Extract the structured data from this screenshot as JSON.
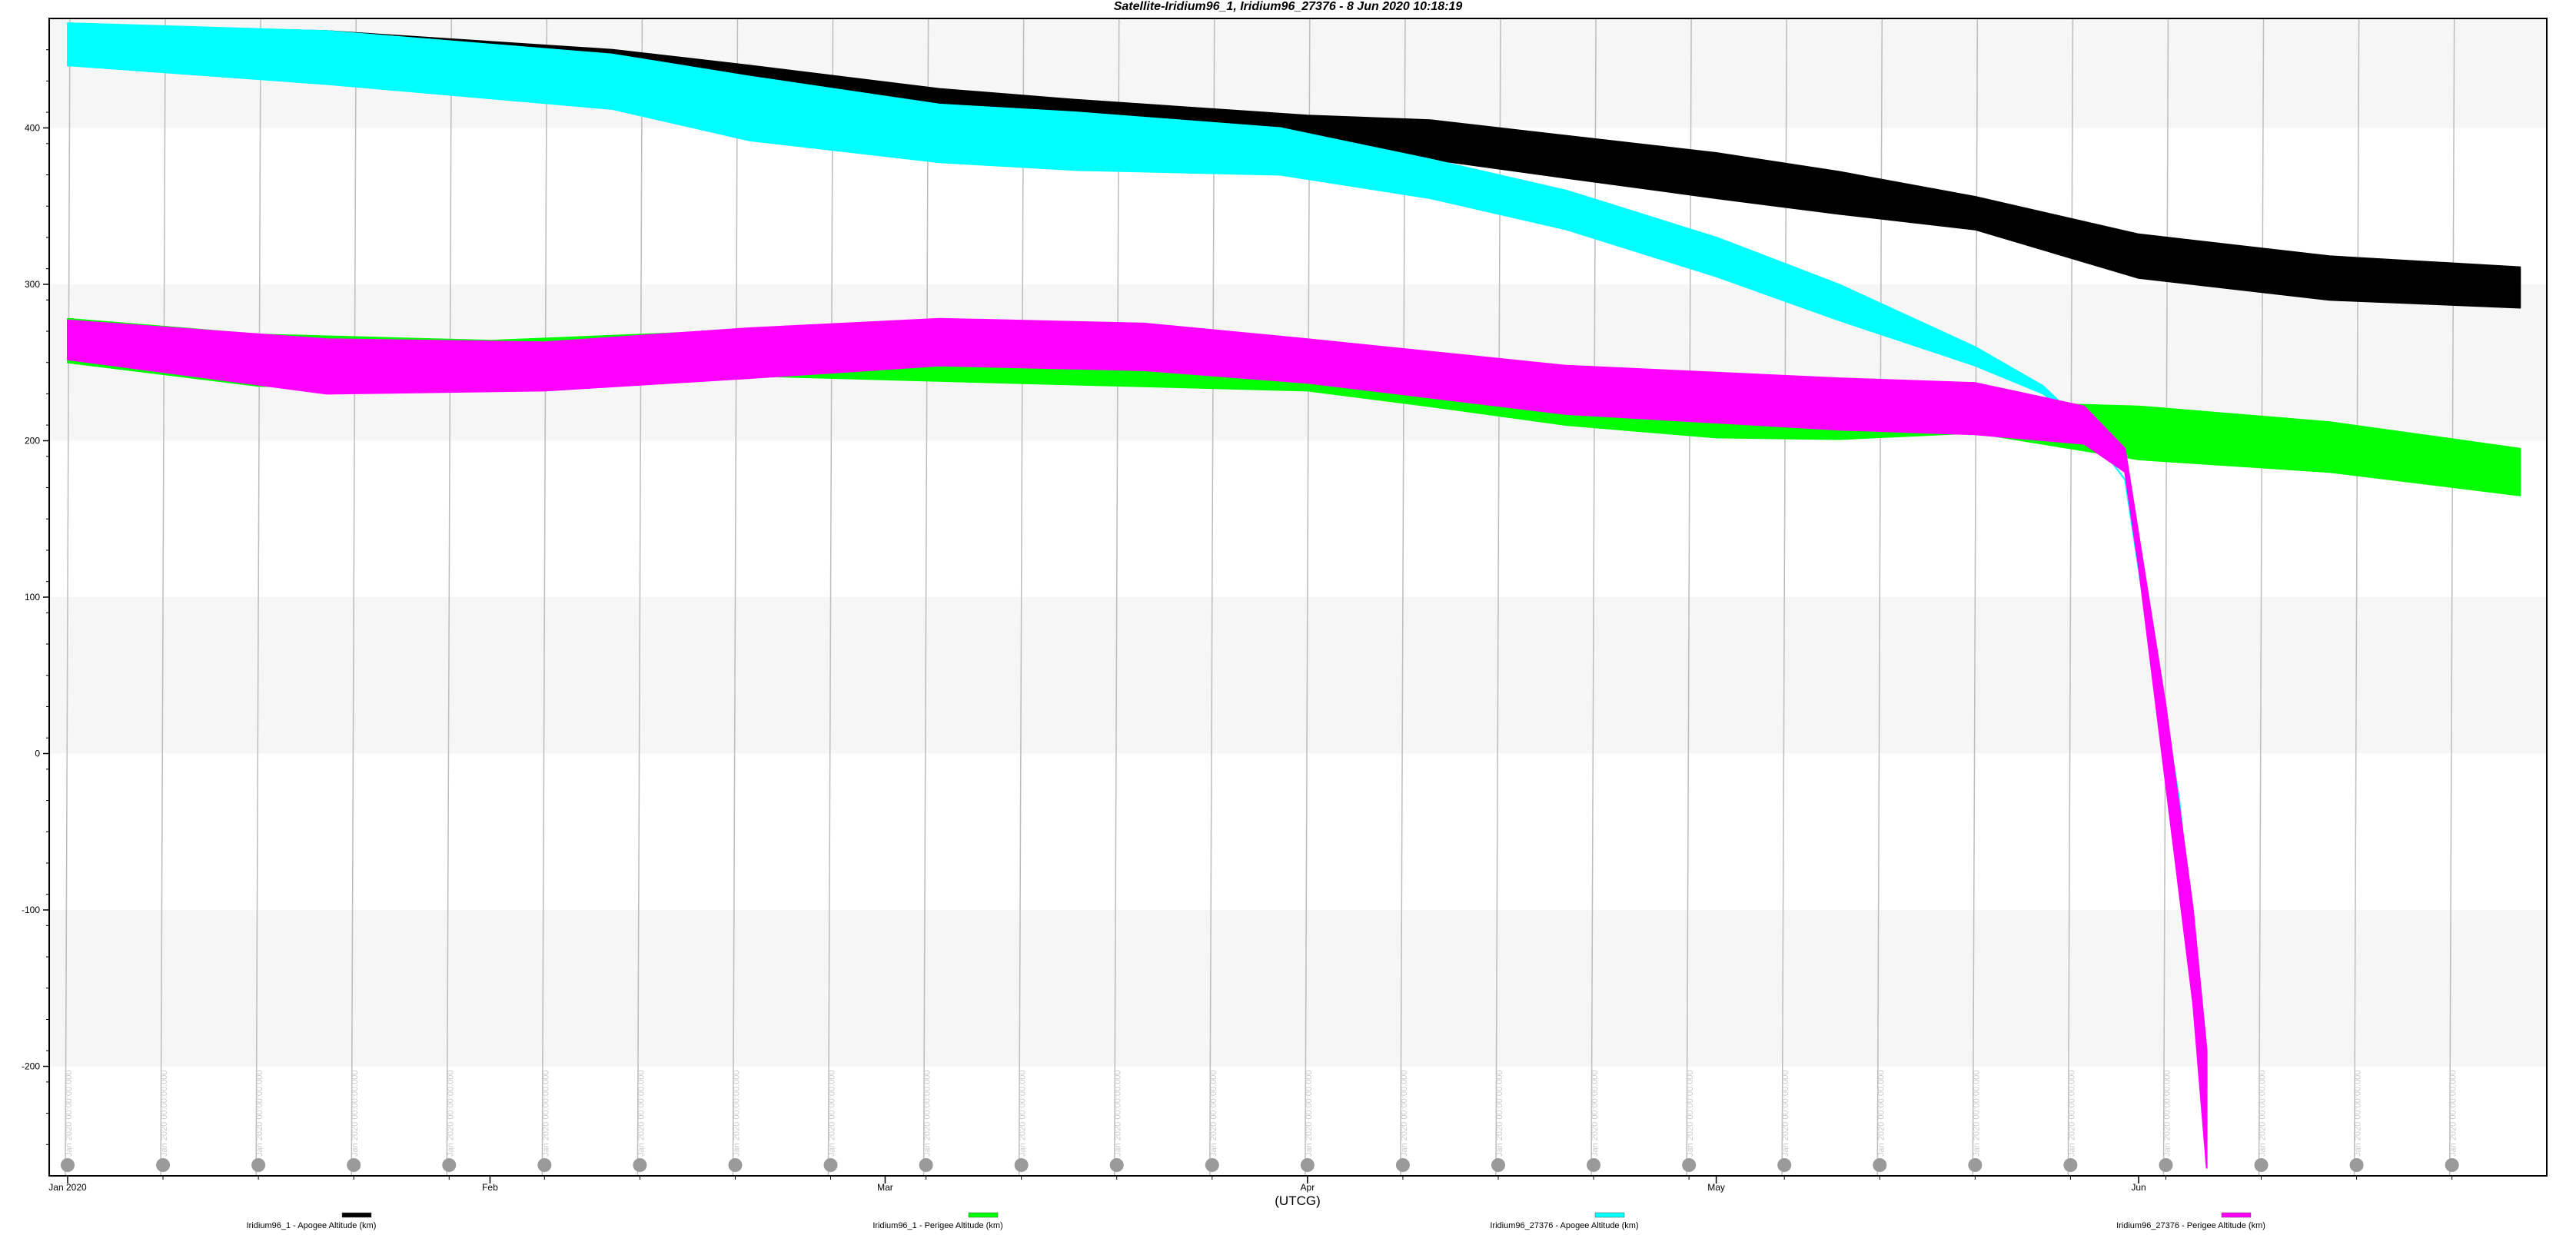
{
  "chart_data": {
    "type": "area",
    "title": "Satellite-Iridium96_1, Iridium96_27376 -  8 Jun 2020 10:18:19",
    "xlabel": "(UTCG)",
    "ylabel": "",
    "x_range": [
      "2020-01-01",
      "2020-06-30"
    ],
    "ylim": [
      -270,
      470
    ],
    "y_ticks": [
      -200,
      -100,
      0,
      100,
      200,
      300,
      400
    ],
    "x_major_ticks": [
      {
        "date": "2020-01-01",
        "label": "Jan 2020"
      },
      {
        "date": "2020-02-01",
        "label": "Feb"
      },
      {
        "date": "2020-03-01",
        "label": "Mar"
      },
      {
        "date": "2020-04-01",
        "label": "Apr"
      },
      {
        "date": "2020-05-01",
        "label": "May"
      },
      {
        "date": "2020-06-01",
        "label": "Jun"
      }
    ],
    "grid": true,
    "y_bands": "alternating light gray every 100 km",
    "legend_placement": "bottom",
    "event_markers": {
      "label": "Jan 2020 00:00:00.000",
      "dates": [
        "2020-01-01",
        "2020-01-08",
        "2020-01-15",
        "2020-01-22",
        "2020-01-29",
        "2020-02-05",
        "2020-02-12",
        "2020-02-19",
        "2020-02-26",
        "2020-03-04",
        "2020-03-11",
        "2020-03-18",
        "2020-03-25",
        "2020-04-01",
        "2020-04-08",
        "2020-04-15",
        "2020-04-22",
        "2020-04-29",
        "2020-05-06",
        "2020-05-13",
        "2020-05-20",
        "2020-05-27",
        "2020-06-03",
        "2020-06-10",
        "2020-06-17",
        "2020-06-24"
      ]
    },
    "series": [
      {
        "name": "Iridium96_1 - Apogee Altitude (km)",
        "color": "#000000",
        "dates": [
          "2020-01-01",
          "2020-01-20",
          "2020-02-10",
          "2020-02-20",
          "2020-03-05",
          "2020-03-15",
          "2020-04-01",
          "2020-04-10",
          "2020-04-20",
          "2020-05-01",
          "2020-05-10",
          "2020-05-20",
          "2020-06-01",
          "2020-06-15",
          "2020-06-29"
        ],
        "upper": [
          466,
          462,
          450,
          440,
          425,
          418,
          408,
          405,
          395,
          384,
          372,
          356,
          332,
          318,
          311
        ],
        "lower": [
          440,
          435,
          425,
          415,
          400,
          395,
          390,
          380,
          368,
          355,
          345,
          335,
          304,
          290,
          285
        ]
      },
      {
        "name": "Iridium96_1 - Perigee Altitude (km)",
        "color": "#00ff00",
        "dates": [
          "2020-01-01",
          "2020-01-15",
          "2020-02-01",
          "2020-02-18",
          "2020-03-10",
          "2020-04-01",
          "2020-04-10",
          "2020-04-20",
          "2020-05-01",
          "2020-05-10",
          "2020-05-20",
          "2020-06-01",
          "2020-06-15",
          "2020-06-29"
        ],
        "upper": [
          278,
          268,
          264,
          270,
          268,
          262,
          255,
          245,
          235,
          228,
          225,
          222,
          212,
          195
        ],
        "lower": [
          250,
          235,
          232,
          242,
          237,
          232,
          222,
          210,
          202,
          201,
          205,
          188,
          180,
          165
        ]
      },
      {
        "name": "Iridium96_27376 - Apogee Altitude (km)",
        "color": "#00ffff",
        "dates": [
          "2020-01-01",
          "2020-01-20",
          "2020-02-10",
          "2020-02-20",
          "2020-03-05",
          "2020-03-15",
          "2020-03-30",
          "2020-04-10",
          "2020-04-20",
          "2020-05-01",
          "2020-05-10",
          "2020-05-20",
          "2020-05-25",
          "2020-05-28",
          "2020-05-31",
          "2020-06-02",
          "2020-06-04",
          "2020-06-06"
        ],
        "upper": [
          467,
          462,
          447,
          433,
          415,
          410,
          400,
          380,
          360,
          330,
          300,
          260,
          235,
          210,
          175,
          80,
          -30,
          -200
        ],
        "lower": [
          440,
          428,
          412,
          392,
          378,
          373,
          370,
          355,
          335,
          305,
          277,
          248,
          230,
          210,
          175,
          60,
          -70,
          -215
        ]
      },
      {
        "name": "Iridium96_27376 - Perigee Altitude (km)",
        "color": "#ff00ff",
        "dates": [
          "2020-01-01",
          "2020-01-20",
          "2020-02-05",
          "2020-02-20",
          "2020-03-05",
          "2020-03-20",
          "2020-04-01",
          "2020-04-20",
          "2020-05-10",
          "2020-05-20",
          "2020-05-28",
          "2020-05-31",
          "2020-06-01",
          "2020-06-03",
          "2020-06-05",
          "2020-06-06"
        ],
        "upper": [
          277,
          265,
          263,
          272,
          278,
          275,
          265,
          248,
          240,
          237,
          222,
          195,
          140,
          30,
          -100,
          -190
        ],
        "lower": [
          252,
          230,
          232,
          240,
          248,
          245,
          237,
          217,
          207,
          204,
          198,
          180,
          120,
          -20,
          -160,
          -265
        ]
      }
    ]
  }
}
